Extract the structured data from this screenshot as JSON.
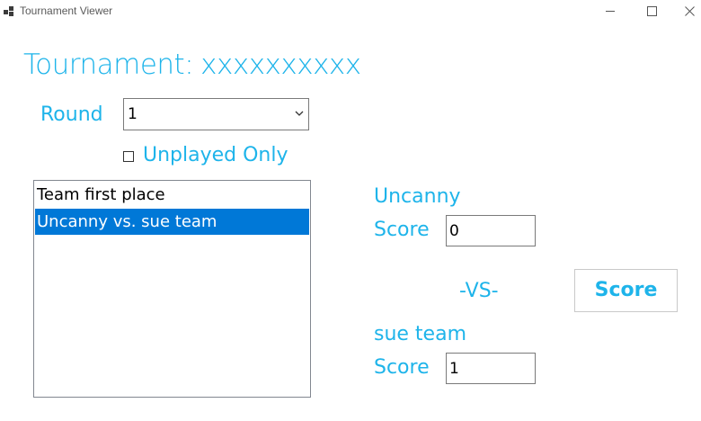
{
  "window": {
    "title": "Tournament Viewer",
    "icon": "app-window-icon"
  },
  "header": {
    "tournament_label": "Tournament:",
    "tournament_name": "xxxxxxxxxx"
  },
  "round": {
    "label": "Round",
    "selected": "1"
  },
  "filter": {
    "unplayed_label": "Unplayed Only",
    "checked": false
  },
  "matchups": [
    {
      "label": "Team first place",
      "selected": false
    },
    {
      "label": "Uncanny vs. sue team",
      "selected": true
    }
  ],
  "team_one": {
    "name": "Uncanny",
    "score_label": "Score",
    "score_value": "0"
  },
  "versus_label": "-VS-",
  "score_button_label": "Score",
  "team_two": {
    "name": "sue team",
    "score_label": "Score",
    "score_value": "1"
  },
  "colors": {
    "accent": "#1eb4ea",
    "selection": "#0078d7"
  }
}
